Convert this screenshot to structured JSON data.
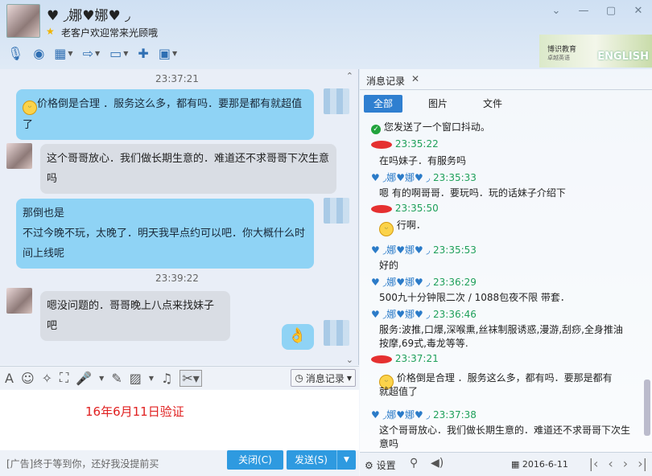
{
  "header": {
    "nickname": "♥ ◞娜♥娜♥ ◞",
    "signature": "老客户欢迎常来光顾哦",
    "window_controls": [
      "⌄",
      "—",
      "▢",
      "✕"
    ],
    "ad": {
      "line1": "博识教育",
      "line2": "卓越英语",
      "line3": "ENGLISH"
    }
  },
  "chat": {
    "ts1": "23:37:21",
    "msg1": "价格倒是合理 ．服务这么多，都有吗．要那是都有就超值了",
    "msg2": "这个哥哥放心．我们做长期生意的．难道还不求哥哥下次生意吗",
    "msg3a": "那倒也是",
    "msg3b": "不过今晚不玩，太晚了．明天我早点约可以吧．你大概什么时间上线呢",
    "ts2": "23:39:22",
    "msg4": "嗯没问题的．哥哥晚上八点来找妹子吧",
    "msg5": "👌"
  },
  "input": {
    "text": "16年6月11日验证",
    "msg_record_label": "消息记录"
  },
  "bottom": {
    "ad_text": "[广告]终于等到你，还好我没提前买",
    "close_label": "关闭(C)",
    "send_label": "发送(S)"
  },
  "history": {
    "tab_label": "消息记录",
    "filters": [
      "全部",
      "图片",
      "文件"
    ],
    "entries": {
      "e0": "您发送了一个窗口抖动。",
      "e1_time": "23:35:22",
      "e1_text": "在吗妹子．有服务吗",
      "e2_name": "♥ ◞娜♥娜♥ ◞",
      "e2_time": "23:35:33",
      "e2_text": "嗯 有的啊哥哥．要玩吗．玩的话妹子介绍下",
      "e3_time": "23:35:50",
      "e3_text": "行啊．",
      "e4_name": "♥ ◞娜♥娜♥ ◞",
      "e4_time": "23:35:53",
      "e4_text": "好的",
      "e5_name": "♥ ◞娜♥娜♥ ◞",
      "e5_time": "23:36:29",
      "e5_text": "500九十分钟限二次 / 1088包夜不限 带套．",
      "e6_name": "♥ ◞娜♥娜♥ ◞",
      "e6_time": "23:36:46",
      "e6_text1": "服务:波推,口爆,深喉熏,丝袜制服诱惑,漫游,刮痧,全身推油",
      "e6_text2": "按摩,69式,毒龙等等.",
      "e7_time": "23:37:21",
      "e7_text1": "价格倒是合理 ．服务这么多，都有吗．要那是都有",
      "e7_text2": "就超值了",
      "e8_name": "♥ ◞娜♥娜♥ ◞",
      "e8_time": "23:37:38",
      "e8_text1": "这个哥哥放心．我们做长期生意的．难道还不求哥哥下次生",
      "e8_text2": "意吗"
    },
    "settings_label": "设置",
    "date": "2016-6-11"
  },
  "colors": {
    "accent": "#2e9ae0",
    "bubble_me": "#8fd3f5",
    "bubble_them": "#d9dde4",
    "time_green": "#1fa05a",
    "name_blue": "#2b7bc8"
  }
}
